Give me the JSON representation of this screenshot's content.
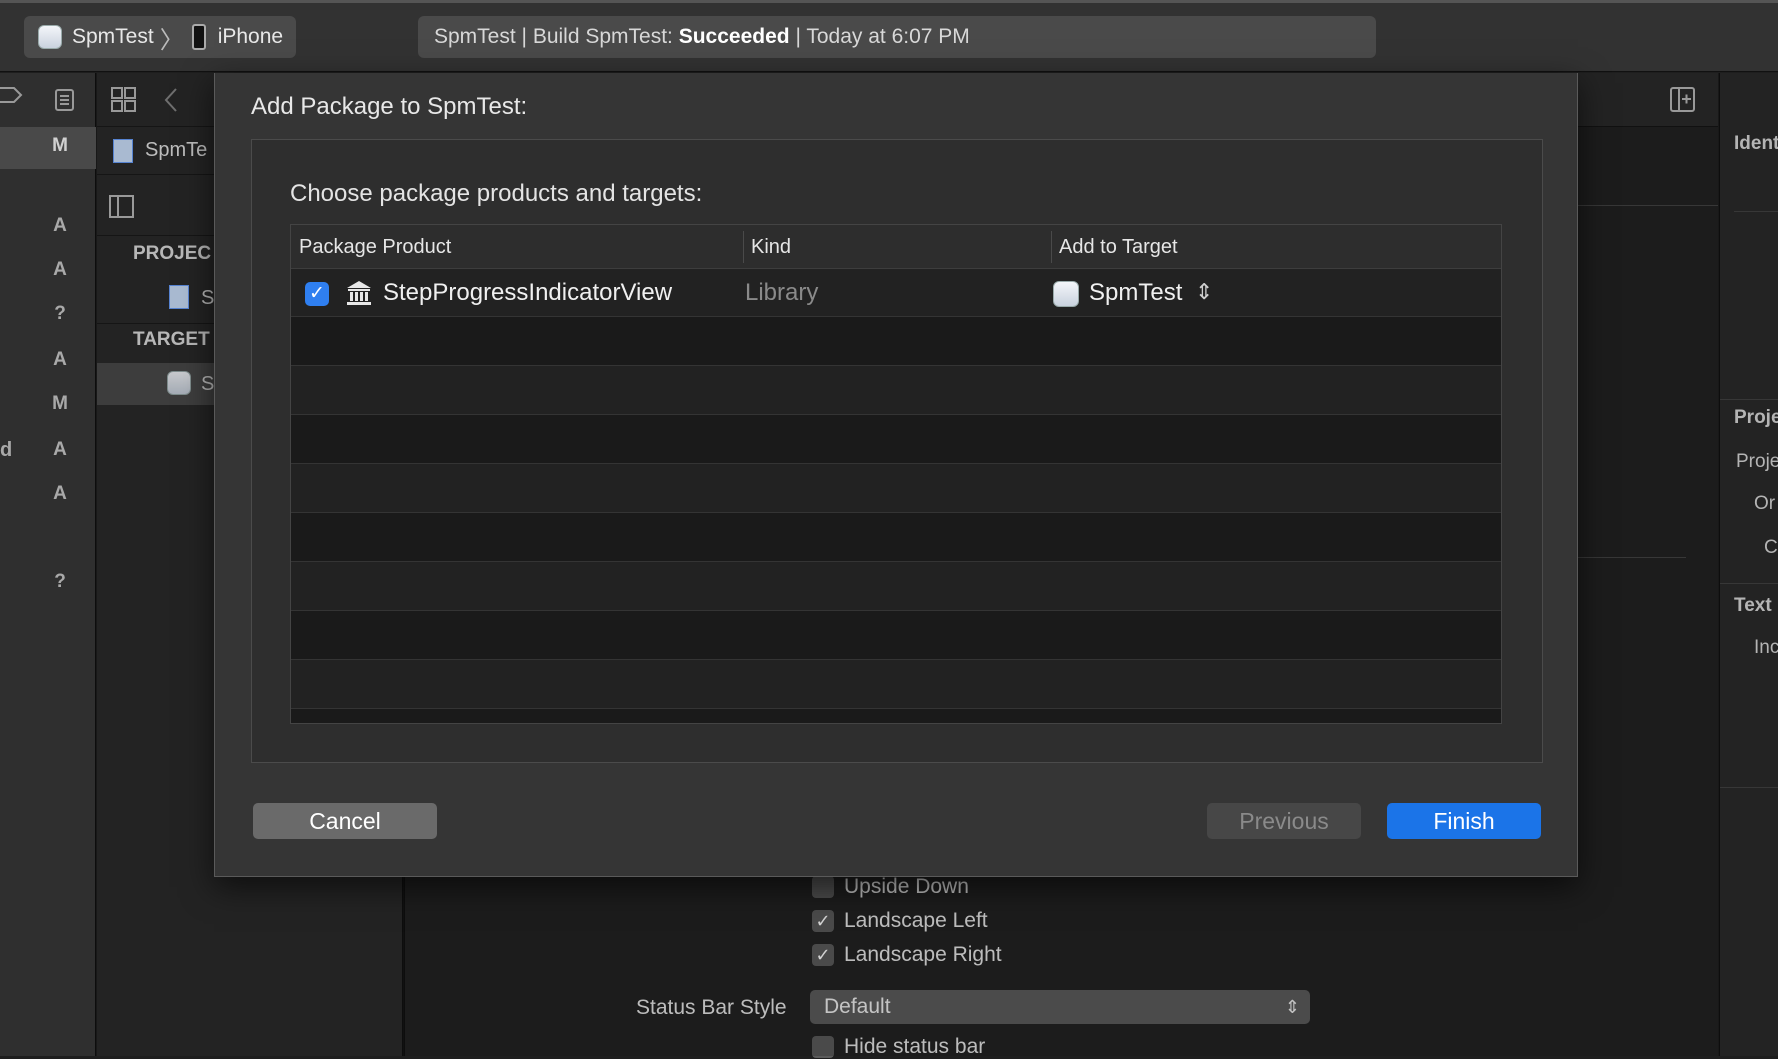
{
  "toolbar": {
    "scheme_name": "SpmTest",
    "scheme_separator": "〉",
    "device_name": "iPhone",
    "activity_prefix": "SpmTest | Build SpmTest: ",
    "activity_status": "Succeeded",
    "activity_suffix": " | Today at 6:07 PM"
  },
  "left_column": {
    "letters": [
      "M",
      "A",
      "A",
      "?",
      "A",
      "M",
      "A",
      "A",
      "?"
    ],
    "edge_glyph": "d"
  },
  "navigator": {
    "file_name": "SpmTe",
    "project_section": "PROJEC",
    "project_item": "S",
    "targets_section": "TARGET",
    "target_item": "S"
  },
  "editor": {
    "orientations": [
      {
        "label": "Upside Down",
        "checked": false
      },
      {
        "label": "Landscape Left",
        "checked": true
      },
      {
        "label": "Landscape Right",
        "checked": true
      }
    ],
    "status_bar_style_label": "Status Bar Style",
    "status_bar_style_value": "Default",
    "hide_status_bar_label": "Hide status bar"
  },
  "inspector": {
    "identity": "Ident",
    "project_doc": "Proje",
    "project_name": "Proje",
    "org": "Or",
    "class": "C",
    "text_settings": "Text",
    "indent": "Inc"
  },
  "dialog": {
    "title": "Add Package to SpmTest:",
    "subtitle": "Choose package products and targets:",
    "columns": [
      "Package Product",
      "Kind",
      "Add to Target"
    ],
    "rows": [
      {
        "checked": true,
        "product": "StepProgressIndicatorView",
        "kind": "Library",
        "target": "SpmTest"
      }
    ],
    "target_arrows": "⌃⌄",
    "buttons": {
      "cancel": "Cancel",
      "previous": "Previous",
      "finish": "Finish"
    }
  },
  "colors": {
    "accent": "#1b74e8",
    "checkbox": "#2f7ff0",
    "window_bg": "#353535"
  }
}
